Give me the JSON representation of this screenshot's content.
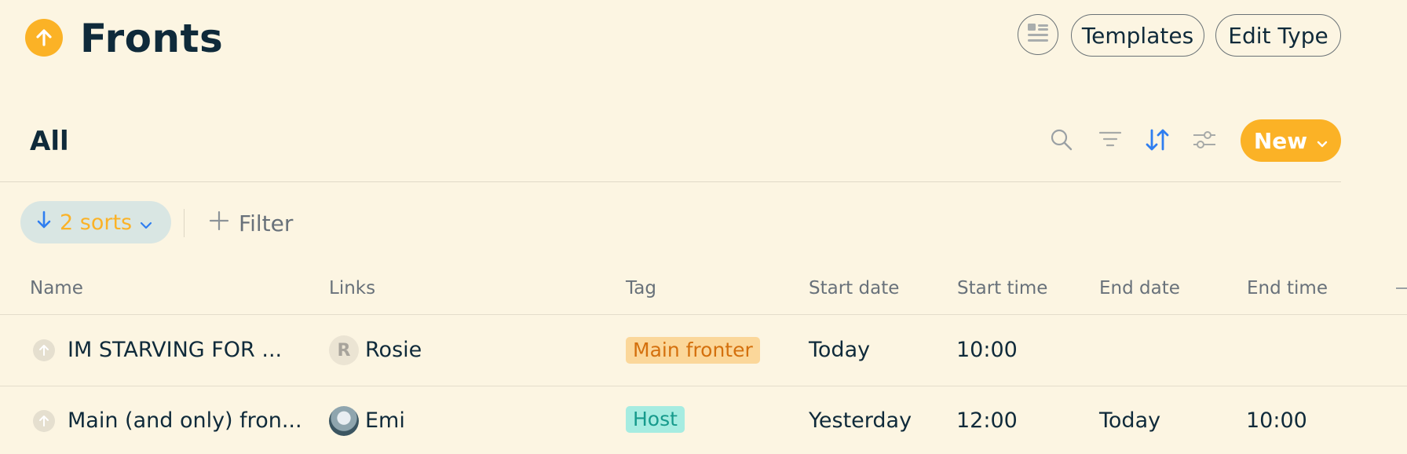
{
  "header": {
    "title": "Fronts",
    "templates_label": "Templates",
    "edit_type_label": "Edit Type"
  },
  "view": {
    "name": "All",
    "new_label": "New"
  },
  "toolbar": {
    "sort_chip_label": "2 sorts",
    "filter_label": "Filter"
  },
  "table": {
    "columns": [
      "Name",
      "Links",
      "Tag",
      "Start date",
      "Start time",
      "End date",
      "End time"
    ],
    "rows": [
      {
        "name": "IM STARVING FOR ...",
        "link_initial": "R",
        "link_name": "Rosie",
        "tag": "Main fronter",
        "start_date": "Today",
        "start_time": "10:00",
        "end_date": "",
        "end_time": ""
      },
      {
        "name": "Main (and only) fron...",
        "link_name": "Emi",
        "tag": "Host",
        "start_date": "Yesterday",
        "start_time": "12:00",
        "end_date": "Today",
        "end_time": "10:00"
      }
    ]
  },
  "colors": {
    "background": "#fcf5e2",
    "accent": "#fbb226",
    "sort_active": "#2f7ef0",
    "tag_main_bg": "#fbd79a",
    "tag_host_bg": "#a6ece1"
  }
}
